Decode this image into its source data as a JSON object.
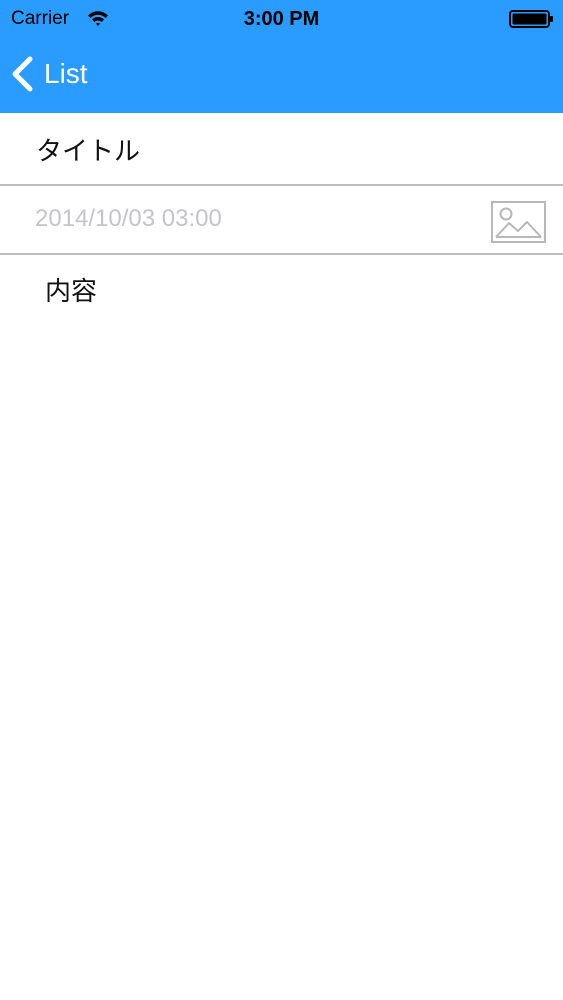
{
  "status_bar": {
    "carrier": "Carrier",
    "time": "3:00 PM",
    "wifi_icon": "wifi-icon",
    "battery_icon": "battery-icon"
  },
  "nav": {
    "back_label": "List",
    "back_icon": "chevron-left-icon",
    "color": "#2b9cff"
  },
  "form": {
    "title_value": "タイトル",
    "date_text": "2014/10/03 03:00",
    "image_icon": "image-placeholder-icon",
    "content_value": "内容"
  }
}
